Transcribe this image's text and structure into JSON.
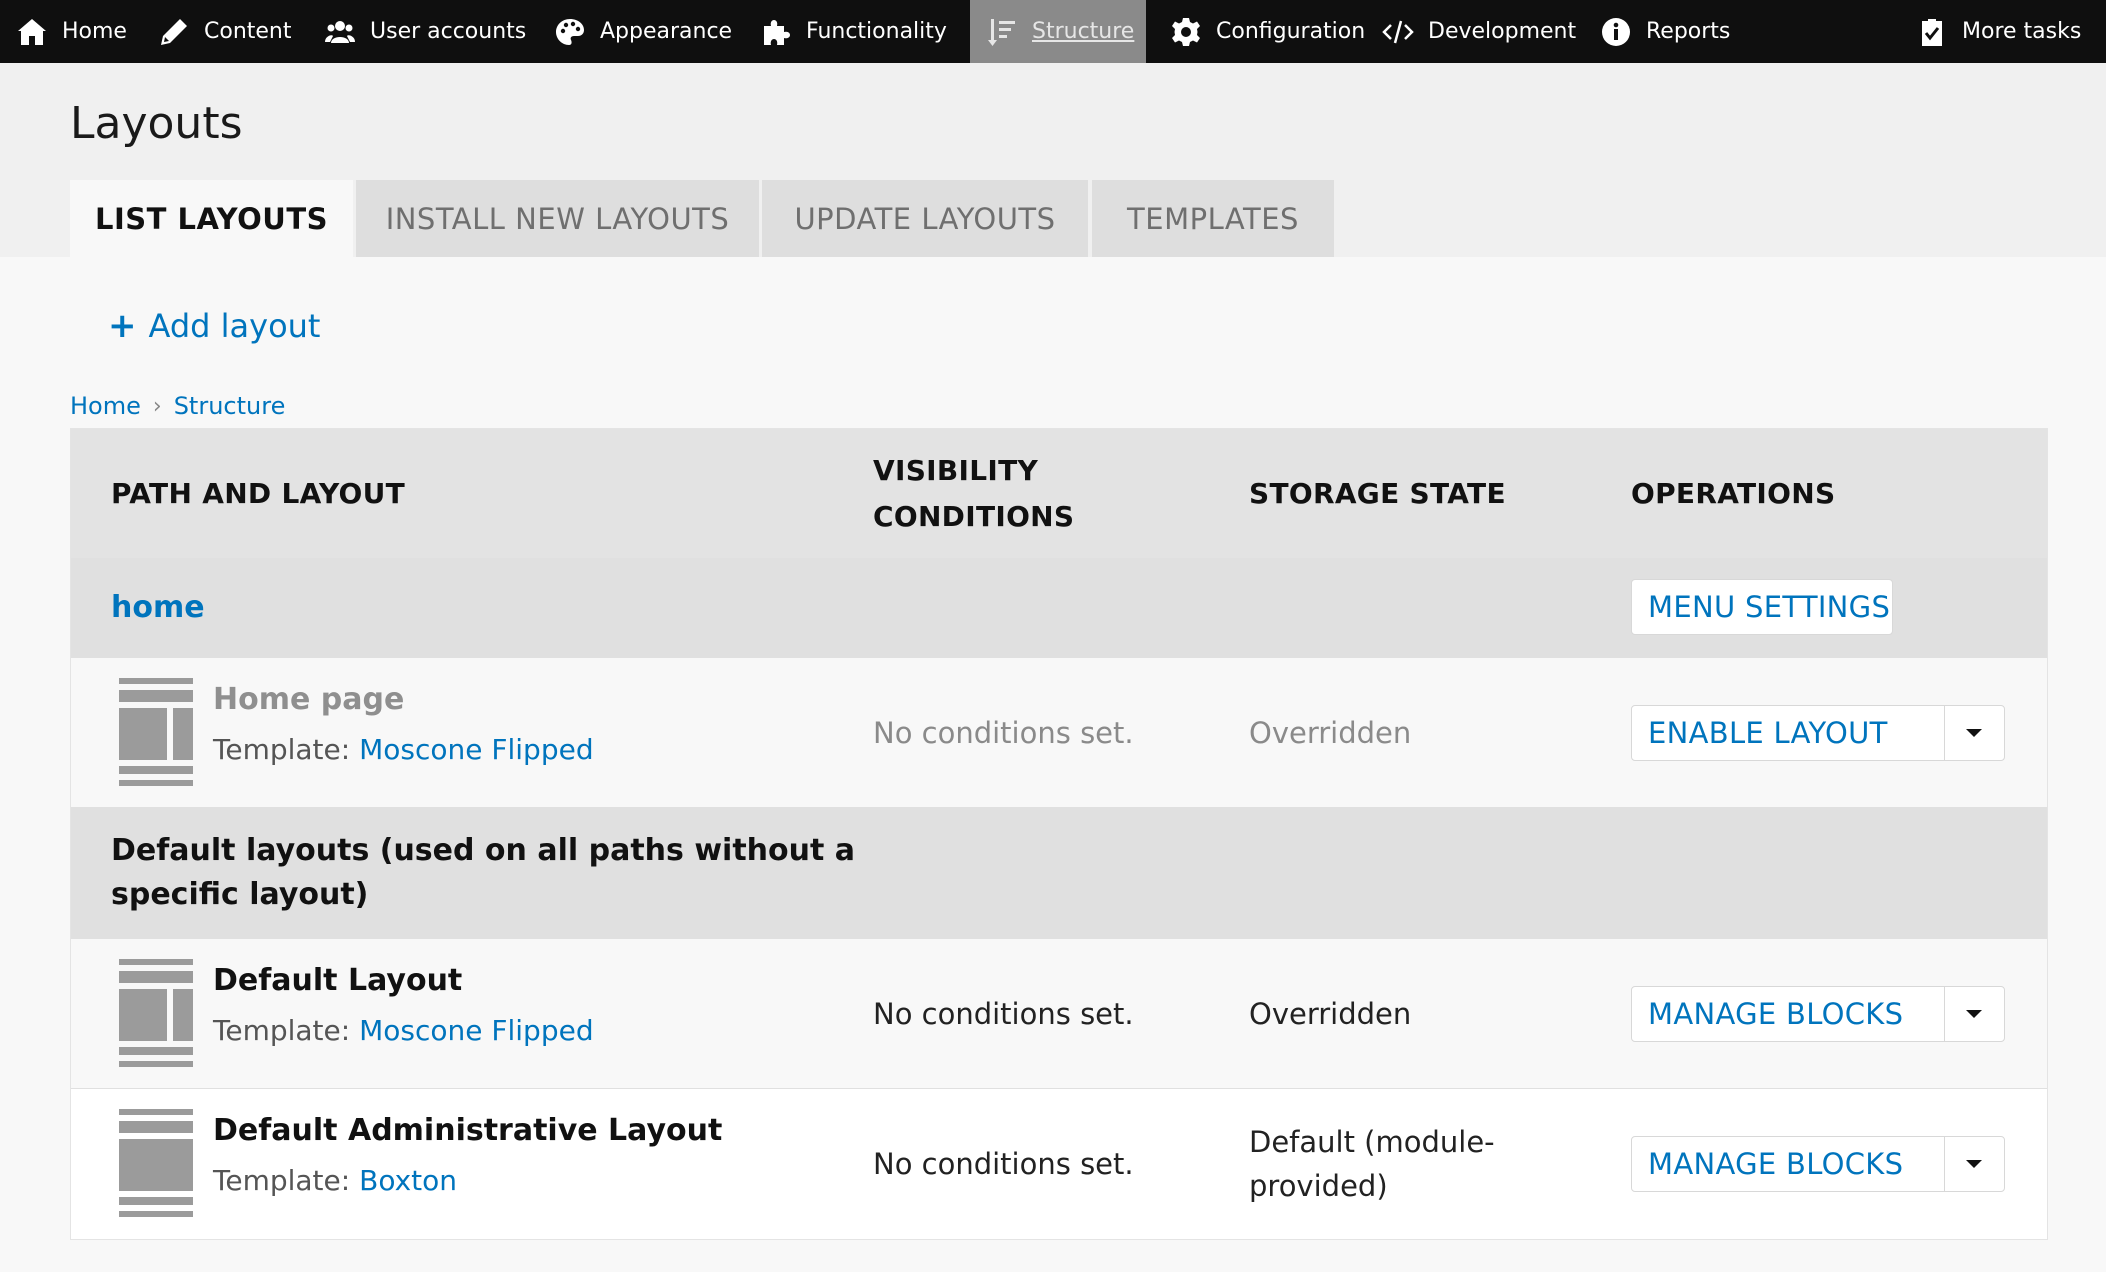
{
  "toolbar": {
    "items": [
      {
        "label": "Home",
        "icon": "home-icon"
      },
      {
        "label": "Content",
        "icon": "pencil-icon"
      },
      {
        "label": "User accounts",
        "icon": "users-icon"
      },
      {
        "label": "Appearance",
        "icon": "palette-icon"
      },
      {
        "label": "Functionality",
        "icon": "puzzle-icon"
      },
      {
        "label": "Structure",
        "icon": "structure-icon",
        "active": true
      },
      {
        "label": "Configuration",
        "icon": "gear-icon"
      },
      {
        "label": "Development",
        "icon": "code-icon"
      },
      {
        "label": "Reports",
        "icon": "info-icon"
      }
    ],
    "more_tasks": {
      "label": "More tasks",
      "icon": "clipboard-check-icon"
    }
  },
  "page": {
    "title": "Layouts"
  },
  "tabs": [
    "LIST LAYOUTS",
    "INSTALL NEW LAYOUTS",
    "UPDATE LAYOUTS",
    "TEMPLATES"
  ],
  "add_layout": {
    "plus": "+",
    "label": "Add layout"
  },
  "breadcrumb": {
    "items": [
      "Home",
      "Structure"
    ],
    "separator": "›"
  },
  "table": {
    "headers": {
      "path": "PATH AND LAYOUT",
      "visibility_line1": "VISIBILITY",
      "visibility_line2": "CONDITIONS",
      "storage": "STORAGE STATE",
      "operations": "OPERATIONS"
    },
    "group_home": {
      "title": "home",
      "button": "MENU SETTINGS"
    },
    "home_row": {
      "name": "Home page",
      "template_prefix": "Template: ",
      "template": "Moscone Flipped",
      "visibility": "No conditions set.",
      "storage": "Overridden",
      "operation": "ENABLE LAYOUT"
    },
    "group_default": {
      "title_line1": "Default layouts (used on all paths without a",
      "title_line2": "specific layout)"
    },
    "default_row": {
      "name": "Default Layout",
      "template_prefix": "Template: ",
      "template": "Moscone Flipped",
      "visibility": "No conditions set.",
      "storage": "Overridden",
      "operation": "MANAGE BLOCKS"
    },
    "admin_row": {
      "name": "Default Administrative Layout",
      "template_prefix": "Template: ",
      "template": "Boxton",
      "visibility": "No conditions set.",
      "storage_line1": "Default (module-",
      "storage_line2": "provided)",
      "operation": "MANAGE BLOCKS"
    }
  },
  "colors": {
    "link": "#0074bd",
    "toolbar_bg": "#0f0f0f",
    "active_tab_bg": "#8a8a8a"
  }
}
